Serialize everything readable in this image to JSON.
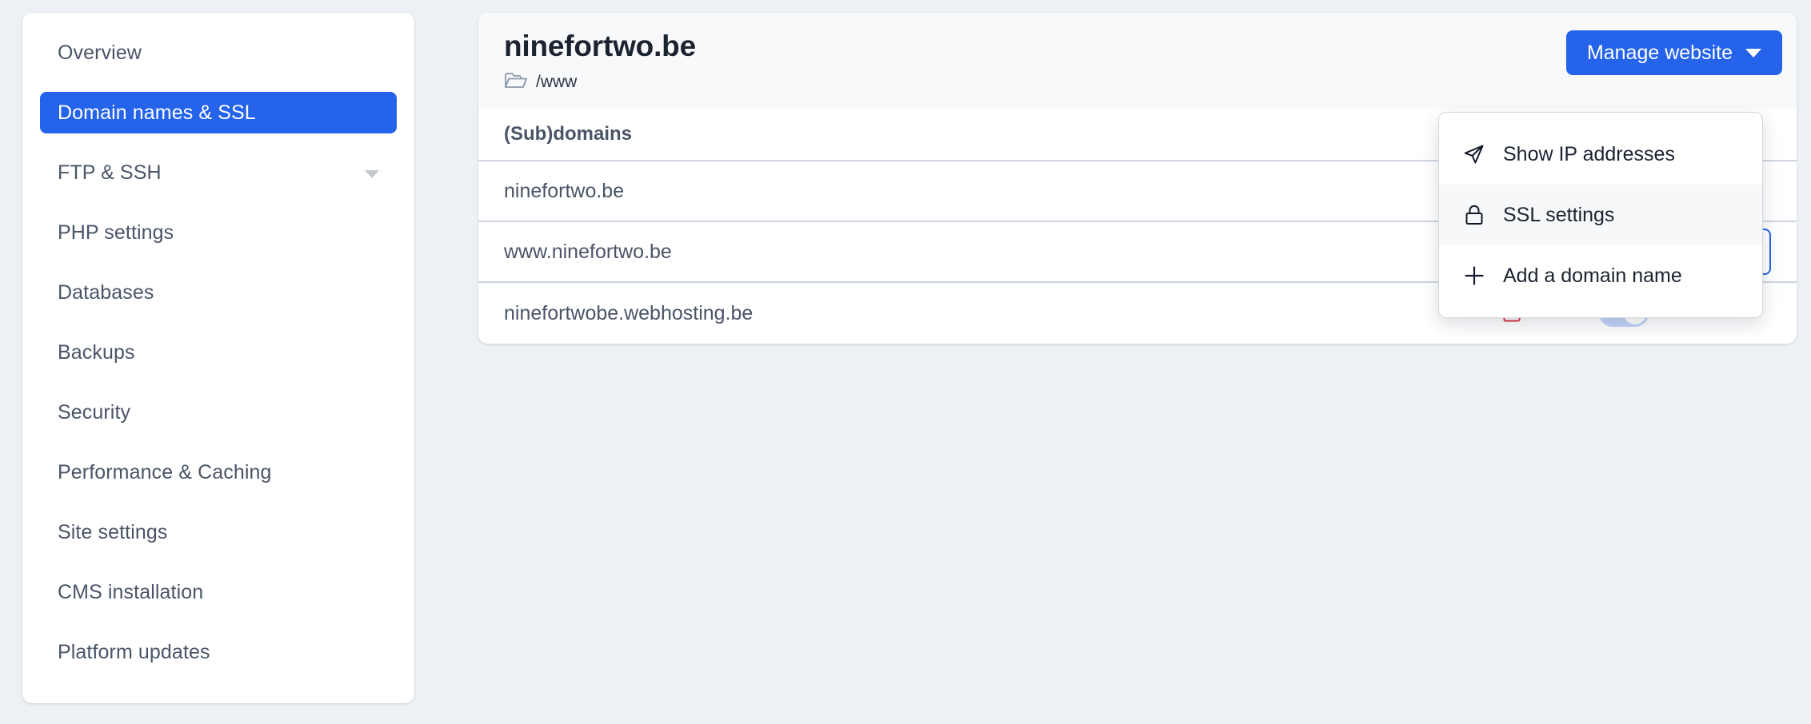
{
  "sidebar": {
    "items": [
      {
        "label": "Overview",
        "active": false,
        "caret": false
      },
      {
        "label": "Domain names & SSL",
        "active": true,
        "caret": false
      },
      {
        "label": "FTP & SSH",
        "active": false,
        "caret": true
      },
      {
        "label": "PHP settings",
        "active": false,
        "caret": false
      },
      {
        "label": "Databases",
        "active": false,
        "caret": false
      },
      {
        "label": "Backups",
        "active": false,
        "caret": false
      },
      {
        "label": "Security",
        "active": false,
        "caret": false
      },
      {
        "label": "Performance & Caching",
        "active": false,
        "caret": false
      },
      {
        "label": "Site settings",
        "active": false,
        "caret": false
      },
      {
        "label": "CMS installation",
        "active": false,
        "caret": false
      },
      {
        "label": "Platform updates",
        "active": false,
        "caret": false
      }
    ]
  },
  "header": {
    "title": "ninefortwo.be",
    "path": "/www",
    "path_icon": "folder-open-icon",
    "manage_button": "Manage website",
    "manage_caret_icon": "caret-down-icon"
  },
  "table": {
    "column_header": "(Sub)domains",
    "rows": [
      {
        "domain": "ninefortwo.be",
        "lock": false,
        "toggle": null,
        "kebab": false
      },
      {
        "domain": "www.ninefortwo.be",
        "lock": true,
        "lock_icon": "lock-closed-icon",
        "toggle": "on",
        "kebab": true,
        "kebab_icon": "kebab-menu-icon"
      },
      {
        "domain": "ninefortwobe.webhosting.be",
        "lock": true,
        "lock_icon": "lock-closed-icon",
        "toggle": "off-muted",
        "kebab": false
      }
    ]
  },
  "dropdown": {
    "items": [
      {
        "label": "Show IP addresses",
        "icon": "send-arrow-icon",
        "hover": false
      },
      {
        "label": "SSL settings",
        "icon": "lock-closed-icon",
        "hover": true
      },
      {
        "label": "Add a domain name",
        "icon": "plus-icon",
        "hover": false
      }
    ]
  },
  "colors": {
    "accent": "#2563eb",
    "page_background": "#edf0f5",
    "lock_red": "#e0434a",
    "divider": "#ccd5e0",
    "toggle_muted": "#c3d4f8"
  }
}
